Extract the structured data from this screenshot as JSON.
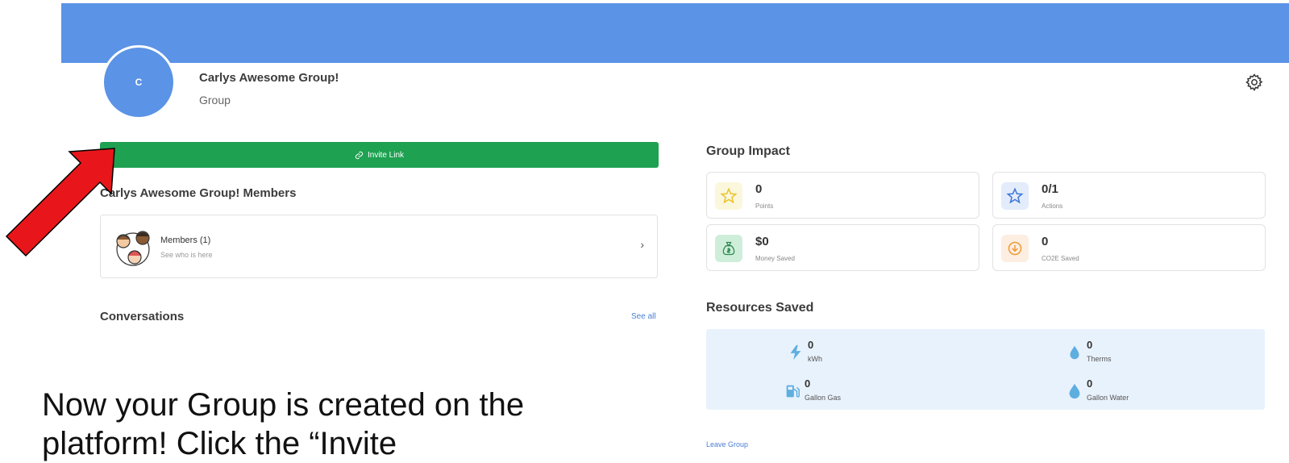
{
  "header": {
    "avatar_initial": "C",
    "group_name": "Carlys Awesome Group!",
    "group_type": "Group",
    "gear_icon": "gear-icon",
    "banner_color": "#5b93e6"
  },
  "invite": {
    "label": "Invite Link",
    "icon": "link-icon",
    "color": "#1ea151"
  },
  "members": {
    "title": "Carlys Awesome Group! Members",
    "card_label": "Members (1)",
    "card_sub": "See who is here",
    "chevron": "›"
  },
  "conversations": {
    "title": "Conversations",
    "see_all": "See all"
  },
  "impact": {
    "title": "Group Impact",
    "stats": [
      {
        "value": "0",
        "label": "Points",
        "icon": "star-icon"
      },
      {
        "value": "0/1",
        "label": "Actions",
        "icon": "star-outline-icon"
      },
      {
        "value": "$0",
        "label": "Money Saved",
        "icon": "money-bag-icon"
      },
      {
        "value": "0",
        "label": "CO2E Saved",
        "icon": "download-circle-icon"
      }
    ]
  },
  "resources": {
    "title": "Resources Saved",
    "items": [
      {
        "value": "0",
        "label": "kWh",
        "icon": "lightning-icon"
      },
      {
        "value": "0",
        "label": "Therms",
        "icon": "flame-drop-icon"
      },
      {
        "value": "0",
        "label": "Gallon Gas",
        "icon": "gas-pump-icon"
      },
      {
        "value": "0",
        "label": "Gallon Water",
        "icon": "water-drop-icon"
      }
    ]
  },
  "leave": {
    "label": "Leave Group"
  },
  "caption": {
    "text": "Now your Group is created on the platform! Click the “Invite"
  }
}
